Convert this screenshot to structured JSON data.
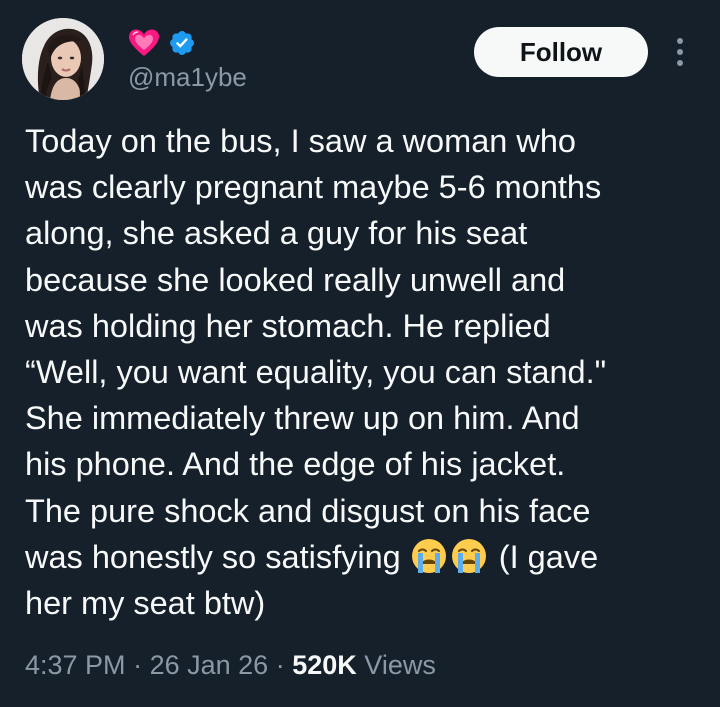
{
  "author": {
    "handle": "@ma1ybe",
    "name_emoji": "heart-icon",
    "verified": true
  },
  "header": {
    "follow_label": "Follow"
  },
  "tweet": {
    "lines": [
      "Today on the bus, I saw a woman who",
      "was clearly pregnant maybe 5-6 months",
      "along, she asked a guy for his seat",
      "because she looked really unwell and",
      "was holding her stomach. He replied",
      "“Well, you want equality, you can stand.\"",
      "She immediately threw up on him. And",
      "his phone. And the edge of his jacket.",
      "The pure shock and disgust on his face",
      "was honestly so satisfying",
      "(I gave",
      "her my seat btw)"
    ],
    "emojis": [
      "crying-face-icon",
      "crying-face-icon"
    ]
  },
  "meta": {
    "time": "4:37 PM",
    "separator": "·",
    "date": "26 Jan 26",
    "views_count": "520K",
    "views_label": "Views"
  },
  "colors": {
    "background": "#15202b",
    "text": "#f7f9f9",
    "secondary": "#8b98a5",
    "verified": "#1d9bf0",
    "heart": "#f91880",
    "emoji": "#ffcc4d",
    "tears": "#5dadec"
  }
}
